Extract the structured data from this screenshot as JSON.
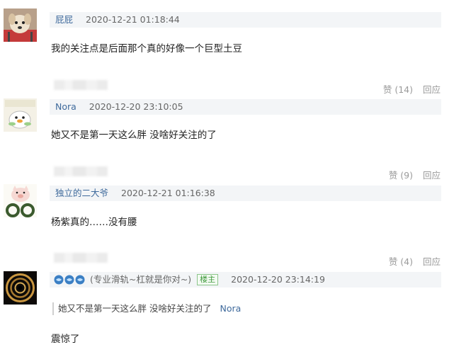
{
  "comments": [
    {
      "username": "屁屁",
      "time": "2020-12-21 01:18:44",
      "content": "我的关注点是后面那个真的好像一个巨型土豆",
      "like_label": "赞 (14)",
      "reply_label": "回应"
    },
    {
      "username": "Nora",
      "time": "2020-12-20 23:10:05",
      "content": "她又不是第一天这么胖 没啥好关注的了",
      "like_label": "赞 (9)",
      "reply_label": "回应"
    },
    {
      "username": "独立的二大爷",
      "time": "2020-12-21 01:16:38",
      "content": "杨紫真的……没有腰",
      "like_label": "赞 (4)",
      "reply_label": "回应"
    },
    {
      "user_tag": "(专业滑轨~杠就是你对~)",
      "owner_badge": "楼主",
      "time": "2020-12-20 23:14:19",
      "quote_text": "她又不是第一天这么胖 没啥好关注的了",
      "quote_author": "Nora",
      "content": "震惊了"
    }
  ],
  "colors": {
    "username": "#3f6a9c",
    "meta_bar_bg": "#f3f5f7",
    "action_text": "#9a9a9a",
    "owner_badge": "#3f9a3c"
  }
}
